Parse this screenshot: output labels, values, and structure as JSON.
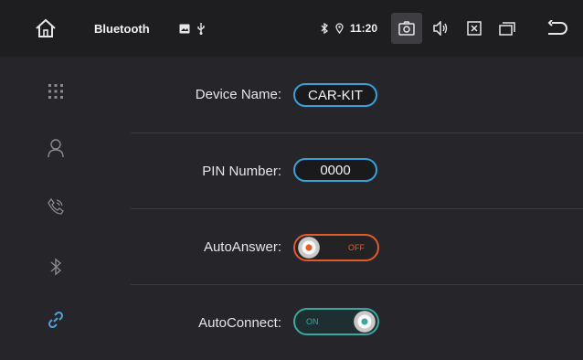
{
  "status_bar": {
    "title": "Bluetooth",
    "time": "11:20",
    "icons": [
      "home-icon",
      "image-icon",
      "usb-icon",
      "bluetooth-icon",
      "location-icon",
      "camera-icon",
      "volume-icon",
      "close-box-icon",
      "windows-icon",
      "back-icon"
    ]
  },
  "sidebar": {
    "items": [
      {
        "icon": "dialpad-icon"
      },
      {
        "icon": "contacts-icon"
      },
      {
        "icon": "call-log-icon"
      },
      {
        "icon": "bluetooth-icon"
      },
      {
        "icon": "link-icon",
        "active": true
      }
    ]
  },
  "settings": {
    "device_name": {
      "label": "Device Name:",
      "value": "CAR-KIT"
    },
    "pin_number": {
      "label": "PIN Number:",
      "value": "0000"
    },
    "auto_answer": {
      "label": "AutoAnswer:",
      "state": "OFF"
    },
    "auto_connect": {
      "label": "AutoConnect:",
      "state": "ON"
    }
  },
  "colors": {
    "accent_blue": "#3aa0d8",
    "toggle_off": "#e05a2a",
    "toggle_on": "#3aa8a0",
    "active_icon": "#4aa3e0"
  }
}
